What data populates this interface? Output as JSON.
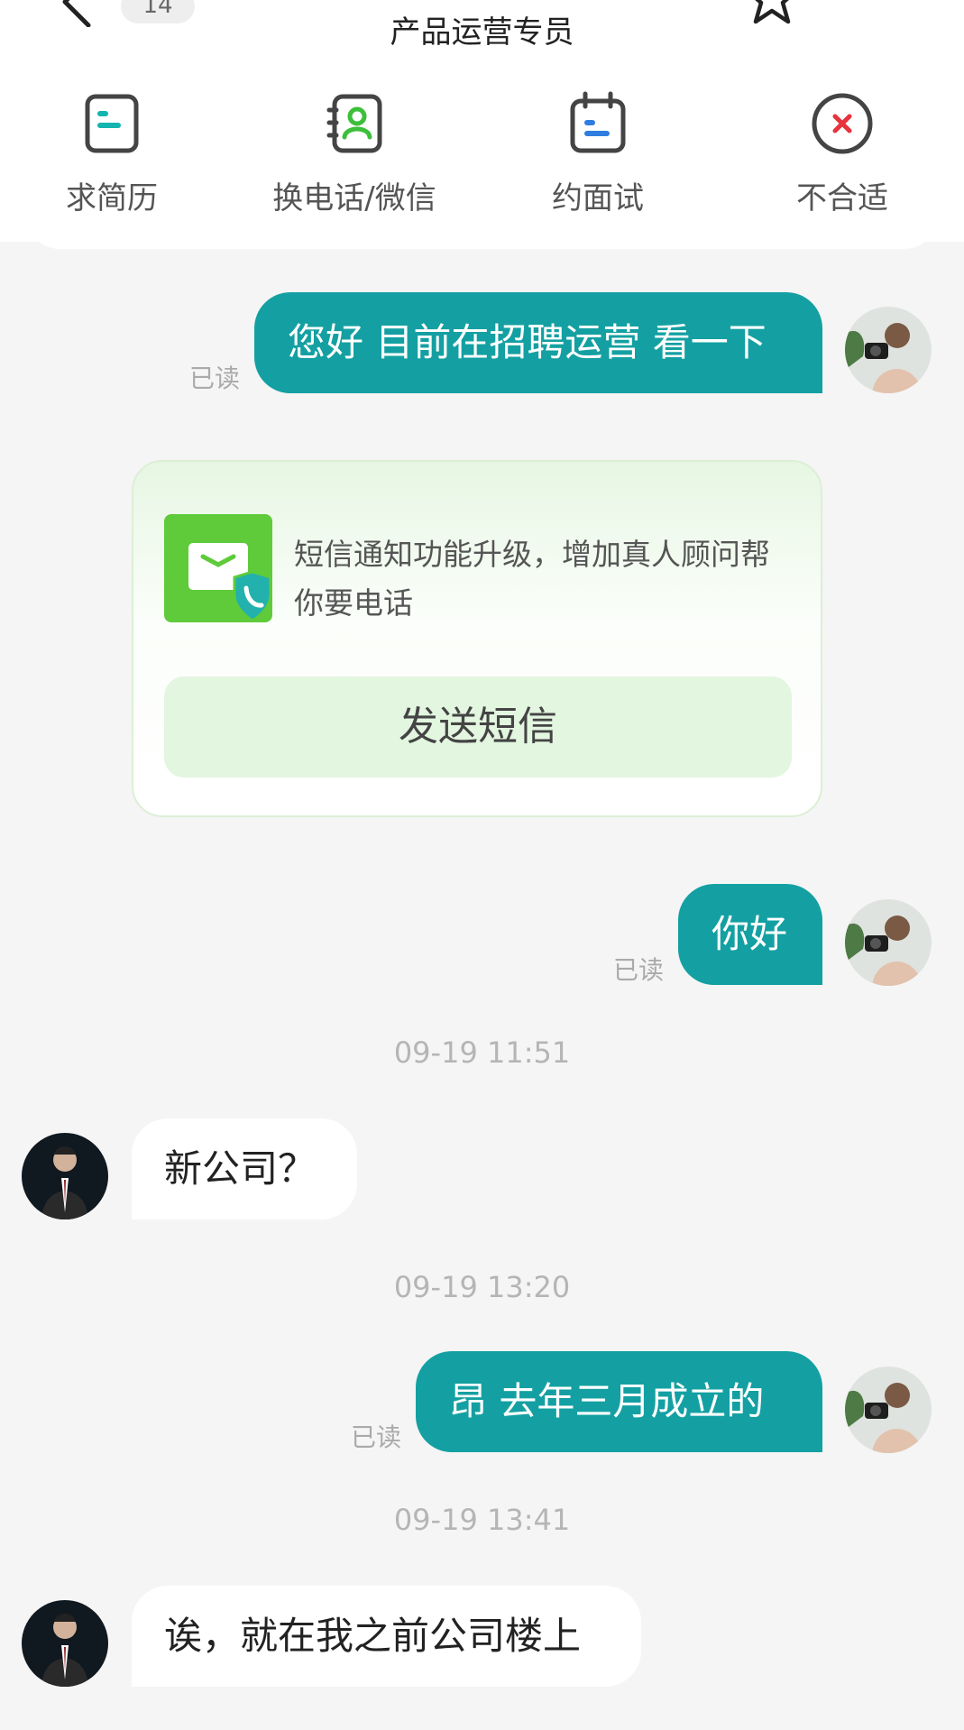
{
  "header": {
    "unread_count": "14",
    "job_title": "产品运营专员"
  },
  "actions": [
    {
      "label": "求简历",
      "icon": "resume-icon"
    },
    {
      "label": "换电话/微信",
      "icon": "contact-card-icon"
    },
    {
      "label": "约面试",
      "icon": "calendar-icon"
    },
    {
      "label": "不合适",
      "icon": "reject-icon"
    }
  ],
  "messages": {
    "m1": {
      "text": "您好 目前在招聘运营 看一下",
      "status": "已读"
    },
    "sms_card": {
      "text": "短信通知功能升级，增加真人顾问帮你要电话",
      "button": "发送短信"
    },
    "m2": {
      "text": "你好",
      "status": "已读"
    },
    "t1": "09-19 11:51",
    "m3": {
      "text": "新公司？"
    },
    "t2": "09-19 13:20",
    "m4": {
      "text": "昂  去年三月成立的",
      "status": "已读"
    },
    "t3": "09-19 13:41",
    "m5": {
      "text": "诶，就在我之前公司楼上"
    }
  },
  "colors": {
    "accent": "#14a0a2",
    "sms_green": "#5fcb3b",
    "reject_red": "#e8323c"
  }
}
